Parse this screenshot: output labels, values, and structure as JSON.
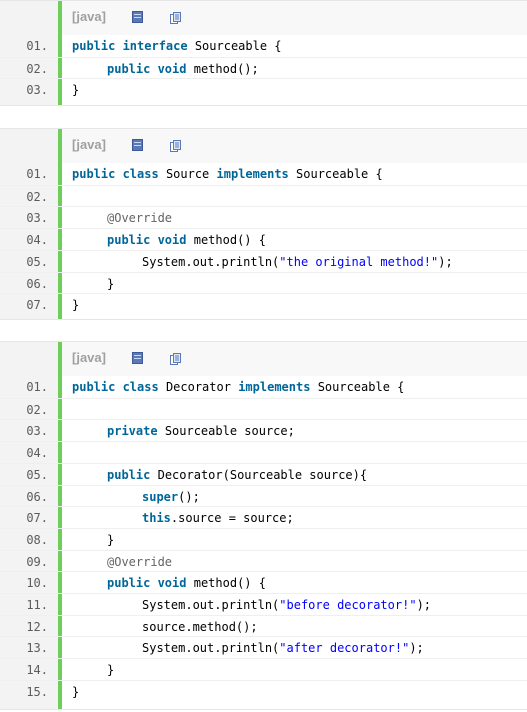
{
  "blocks": [
    {
      "lang_label": "[java]",
      "lines": [
        {
          "num": "01.",
          "tokens": [
            [
              "kw",
              "public interface"
            ],
            [
              "",
              "Sourceable {"
            ]
          ],
          "indent": 0
        },
        {
          "num": "02.",
          "tokens": [
            [
              "kw",
              "public void"
            ],
            [
              "",
              "method();"
            ]
          ],
          "indent": 1
        },
        {
          "num": "03.",
          "tokens": [
            [
              "",
              "}"
            ]
          ],
          "indent": 0
        }
      ]
    },
    {
      "lang_label": "[java]",
      "lines": [
        {
          "num": "01.",
          "tokens": [
            [
              "kw",
              "public class"
            ],
            [
              "",
              "Source"
            ],
            [
              "kw",
              "implements"
            ],
            [
              "",
              "Sourceable {"
            ]
          ],
          "indent": 0
        },
        {
          "num": "02.",
          "tokens": [],
          "indent": 0
        },
        {
          "num": "03.",
          "tokens": [
            [
              "ann",
              "@Override"
            ]
          ],
          "indent": 1
        },
        {
          "num": "04.",
          "tokens": [
            [
              "kw",
              "public void"
            ],
            [
              "",
              "method() {"
            ]
          ],
          "indent": 1
        },
        {
          "num": "05.",
          "tokens": [
            [
              "",
              "System.out.println("
            ],
            [
              "str",
              "\"the original method!\""
            ],
            [
              "",
              ");"
            ]
          ],
          "indent": 2
        },
        {
          "num": "06.",
          "tokens": [
            [
              "",
              "}"
            ]
          ],
          "indent": 1
        },
        {
          "num": "07.",
          "tokens": [
            [
              "",
              "}"
            ]
          ],
          "indent": 0
        }
      ]
    },
    {
      "lang_label": "[java]",
      "lines": [
        {
          "num": "01.",
          "tokens": [
            [
              "kw",
              "public class"
            ],
            [
              "",
              "Decorator"
            ],
            [
              "kw",
              "implements"
            ],
            [
              "",
              "Sourceable {"
            ]
          ],
          "indent": 0
        },
        {
          "num": "02.",
          "tokens": [],
          "indent": 0
        },
        {
          "num": "03.",
          "tokens": [
            [
              "kw",
              "private"
            ],
            [
              "",
              "Sourceable source;"
            ]
          ],
          "indent": 1
        },
        {
          "num": "04.",
          "tokens": [],
          "indent": 0
        },
        {
          "num": "05.",
          "tokens": [
            [
              "kw",
              "public"
            ],
            [
              "",
              "Decorator(Sourceable source){"
            ]
          ],
          "indent": 1
        },
        {
          "num": "06.",
          "tokens": [
            [
              "kw",
              "super"
            ],
            [
              "",
              "();"
            ]
          ],
          "indent": 2
        },
        {
          "num": "07.",
          "tokens": [
            [
              "kw",
              "this"
            ],
            [
              "",
              ".source = source;"
            ]
          ],
          "indent": 2
        },
        {
          "num": "08.",
          "tokens": [
            [
              "",
              "}"
            ]
          ],
          "indent": 1
        },
        {
          "num": "09.",
          "tokens": [
            [
              "ann",
              "@Override"
            ]
          ],
          "indent": 1
        },
        {
          "num": "10.",
          "tokens": [
            [
              "kw",
              "public void"
            ],
            [
              "",
              "method() {"
            ]
          ],
          "indent": 1
        },
        {
          "num": "11.",
          "tokens": [
            [
              "",
              "System.out.println("
            ],
            [
              "str",
              "\"before decorator!\""
            ],
            [
              "",
              ");"
            ]
          ],
          "indent": 2
        },
        {
          "num": "12.",
          "tokens": [
            [
              "",
              "source.method();"
            ]
          ],
          "indent": 2
        },
        {
          "num": "13.",
          "tokens": [
            [
              "",
              "System.out.println("
            ],
            [
              "str",
              "\"after decorator!\""
            ],
            [
              "",
              ");"
            ]
          ],
          "indent": 2
        },
        {
          "num": "14.",
          "tokens": [
            [
              "",
              "}"
            ]
          ],
          "indent": 1
        },
        {
          "num": "15.",
          "tokens": [
            [
              "",
              "}"
            ]
          ],
          "indent": 0
        }
      ]
    }
  ]
}
